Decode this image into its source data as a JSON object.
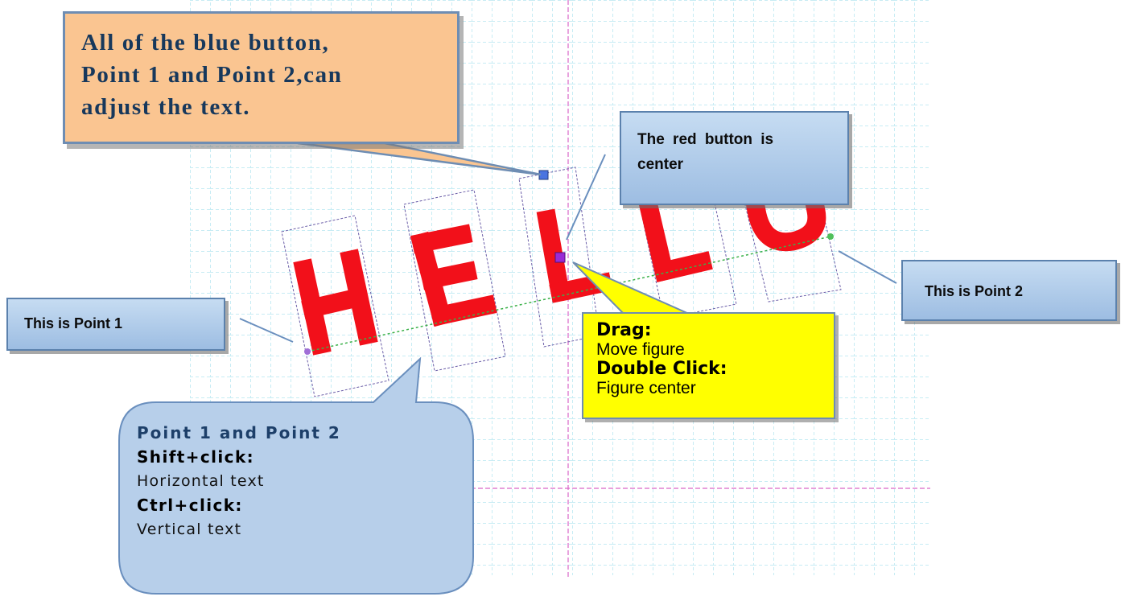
{
  "canvas": {
    "text": "HELLO",
    "letter_color": "#f2101a",
    "grid_color": "#8fd8e8",
    "axis_color": "#d966c8",
    "baseline_color": "#3bb14a",
    "handles": {
      "rotate_handle_color": "#4a74e0",
      "center_handle_color": "#9a2bd6",
      "point_1_color": "#a06ed6",
      "point_2_color": "#4fc05b"
    }
  },
  "callouts": {
    "blue_buttons_note": {
      "lines": [
        "All of the blue button,",
        "Point 1 and Point 2,can",
        "adjust the text."
      ],
      "fill": "#fac591"
    },
    "red_button_note": {
      "lines": [
        "The red button is",
        "center"
      ]
    },
    "point_1_label": "This is Point 1",
    "point_2_label": "This is Point 2",
    "drag_note": {
      "drag_heading": "Drag:",
      "drag_body": "Move figure",
      "double_click_heading": "Double Click:",
      "double_click_body": "Figure center",
      "fill": "#ffff00"
    },
    "modifier_note": {
      "title": "Point 1 and Point 2",
      "shift_heading": "Shift+click:",
      "shift_body": "Horizontal text",
      "ctrl_heading": "Ctrl+click:",
      "ctrl_body": "Vertical text"
    }
  }
}
